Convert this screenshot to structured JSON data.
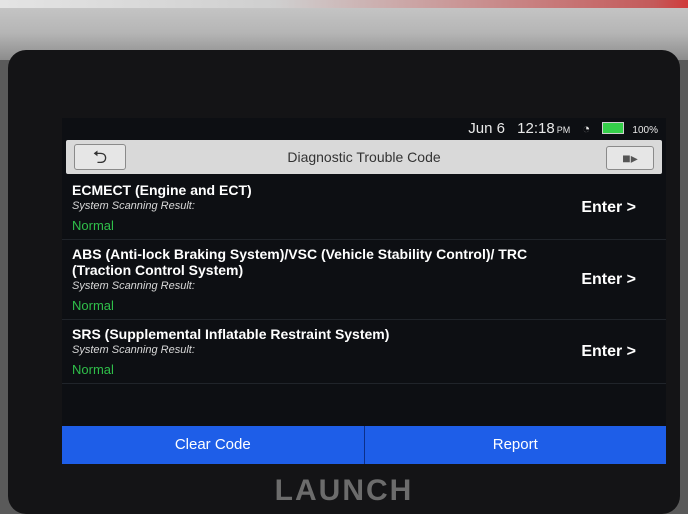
{
  "status": {
    "date": "Jun 6",
    "time": "12:18",
    "ampm": "PM",
    "battery": "100%"
  },
  "header": {
    "title": "Diagnostic Trouble Code"
  },
  "systems": [
    {
      "name": "ECMECT (Engine and ECT)",
      "label": "System Scanning Result:",
      "result": "Normal",
      "action": "Enter >"
    },
    {
      "name": "ABS (Anti-lock Braking System)/VSC (Vehicle Stability Control)/ TRC (Traction Control System)",
      "label": "System Scanning Result:",
      "result": "Normal",
      "action": "Enter >"
    },
    {
      "name": "SRS (Supplemental Inflatable Restraint System)",
      "label": "System Scanning Result:",
      "result": "Normal",
      "action": "Enter >"
    }
  ],
  "footer": {
    "clear_code": "Clear Code",
    "report": "Report"
  },
  "brand": "LAUNCH",
  "colors": {
    "normal": "#2fbf4a",
    "button": "#1e5ee8",
    "titlebar": "#d9d9d9"
  }
}
